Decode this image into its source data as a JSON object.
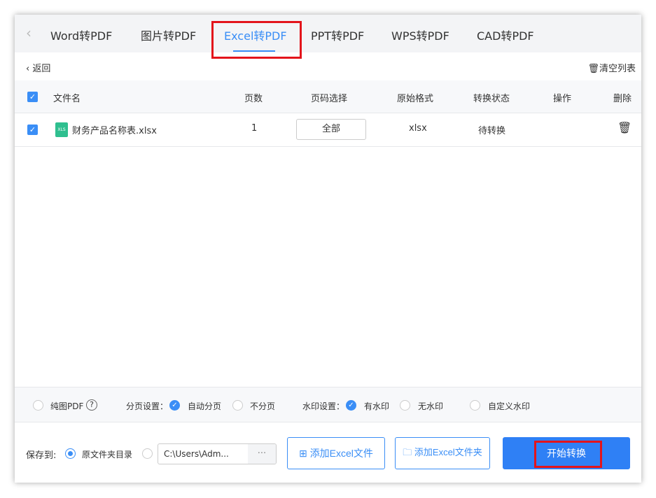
{
  "tabs": [
    "Word转PDF",
    "图片转PDF",
    "Excel转PDF",
    "PPT转PDF",
    "WPS转PDF",
    "CAD转PDF"
  ],
  "back": "返回",
  "clear_list": "清空列表",
  "columns": [
    "文件名",
    "页数",
    "页码选择",
    "原始格式",
    "转换状态",
    "操作",
    "删除"
  ],
  "rows": [
    {
      "name": "财务产品名称表.xlsx",
      "pages": "1",
      "page_select": "全部",
      "format": "xlsx",
      "status": "待转换",
      "icon_text": "XLS"
    }
  ],
  "options": {
    "pure_pdf": "纯图PDF",
    "help": "?",
    "paging_label": "分页设置：",
    "auto_page": "自动分页",
    "no_page": "不分页",
    "watermark_label": "水印设置：",
    "with_wm": "有水印",
    "no_wm": "无水印",
    "custom_wm": "自定义水印"
  },
  "save": {
    "label": "保存到:",
    "original_dir": "原文件夹目录",
    "path": "C:\\Users\\Adm...",
    "more": "···"
  },
  "buttons": {
    "add_file": "添加Excel文件",
    "add_folder": "添加Excel文件夹",
    "start": "开始转换"
  }
}
